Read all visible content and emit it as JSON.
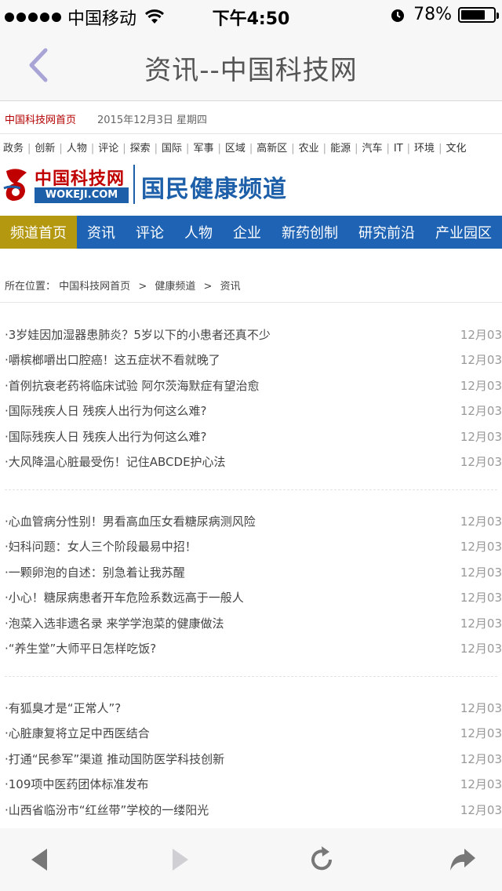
{
  "status_bar": {
    "carrier": "中国移动",
    "time": "下午4:50",
    "battery_percent": "78%",
    "battery_level": 0.78
  },
  "nav": {
    "title": "资讯--中国科技网"
  },
  "info": {
    "home_link": "中国科技网首页",
    "date": "2015年12月3日   星期四"
  },
  "categories": [
    "政务",
    "创新",
    "人物",
    "评论",
    "探索",
    "国际",
    "军事",
    "区域",
    "高新区",
    "农业",
    "能源",
    "汽车",
    "IT",
    "环境",
    "文化"
  ],
  "logo": {
    "cn_name": "中国科技网",
    "en_name": "WOKEJI.COM",
    "channel": "国民健康频道"
  },
  "channel_bar": {
    "home": "频道首页",
    "items": [
      "资讯",
      "评论",
      "人物",
      "企业",
      "新药创制",
      "研究前沿",
      "产业园区"
    ]
  },
  "breadcrumb": {
    "label": "所在位置：",
    "items": [
      "中国科技网首页",
      "健康频道",
      "资讯"
    ],
    "sep": ">"
  },
  "news_groups": [
    [
      {
        "title": "·3岁娃因加湿器患肺炎？5岁以下的小患者还真不少",
        "date": "12月03"
      },
      {
        "title": "·嚼槟榔嚼出口腔癌！这五症状不看就晚了",
        "date": "12月03"
      },
      {
        "title": "·首例抗衰老药将临床试验 阿尔茨海默症有望治愈",
        "date": "12月03"
      },
      {
        "title": "·国际残疾人日 残疾人出行为何这么难?",
        "date": "12月03"
      },
      {
        "title": "·国际残疾人日 残疾人出行为何这么难?",
        "date": "12月03"
      },
      {
        "title": "·大风降温心脏最受伤！记住ABCDE护心法",
        "date": "12月03"
      }
    ],
    [
      {
        "title": "·心血管病分性别！男看高血压女看糖尿病测风险",
        "date": "12月03"
      },
      {
        "title": "·妇科问题：女人三个阶段最易中招！",
        "date": "12月03"
      },
      {
        "title": "·一颗卵泡的自述：别急着让我苏醒",
        "date": "12月03"
      },
      {
        "title": "·小心！糖尿病患者开车危险系数远高于一般人",
        "date": "12月03"
      },
      {
        "title": "·泡菜入选非遗名录 来学学泡菜的健康做法",
        "date": "12月03"
      },
      {
        "title": "·“养生堂”大师平日怎样吃饭?",
        "date": "12月03"
      }
    ],
    [
      {
        "title": "·有狐臭才是“正常人”?",
        "date": "12月03"
      },
      {
        "title": "·心脏康复将立足中西医结合",
        "date": "12月03"
      },
      {
        "title": "·打通“民参军”渠道 推动国防医学科技创新",
        "date": "12月03"
      },
      {
        "title": "·109项中医药团体标准发布",
        "date": "12月03"
      },
      {
        "title": "·山西省临汾市“红丝带”学校的一缕阳光",
        "date": "12月03"
      }
    ]
  ],
  "toolbar": {
    "icons": [
      "back-arrow-icon",
      "forward-arrow-icon",
      "refresh-icon",
      "share-icon"
    ]
  },
  "colors": {
    "channel_bar": "#1e63b4",
    "channel_home": "#b4980f",
    "brand_red": "#c00000",
    "home_link": "#b40000",
    "ios_tint": "#a9a4d6"
  }
}
